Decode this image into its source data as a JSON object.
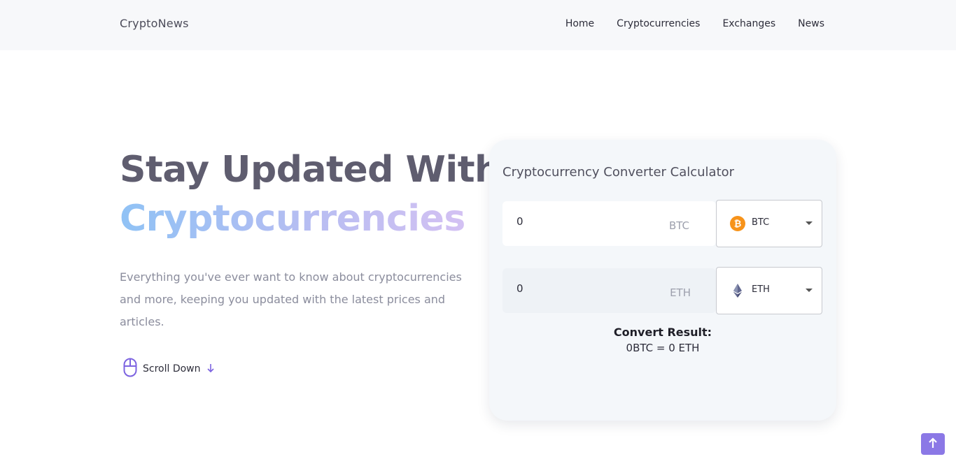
{
  "header": {
    "logo": "CryptoNews",
    "nav": [
      "Home",
      "Cryptocurrencies",
      "Exchanges",
      "News"
    ]
  },
  "hero": {
    "title_line1": "Stay Updated With",
    "title_line2": "Cryptocurrencies",
    "description": "Everything you've ever want to know about cryptocurrencies and more, keeping you updated with the latest prices and articles.",
    "scroll_label": "Scroll Down"
  },
  "converter": {
    "title": "Cryptocurrency Converter Calculator",
    "from": {
      "amount": "0",
      "unit": "BTC",
      "selected": "BTC",
      "icon": "bitcoin-icon"
    },
    "to": {
      "amount": "0",
      "unit": "ETH",
      "selected": "ETH",
      "icon": "ethereum-icon"
    },
    "result_title": "Convert Result:",
    "result_value": "0BTC = 0 ETH"
  },
  "colors": {
    "accent": "#8b78e6",
    "bitcoin": "#f7931a",
    "ethereum": "#62688f",
    "gradient_start": "#90c2f5",
    "gradient_end": "#dac2f3"
  },
  "icons": {
    "scroll": "mouse-icon",
    "scroll_arrow": "arrow-down-icon",
    "back_to_top": "arrow-up-icon"
  }
}
